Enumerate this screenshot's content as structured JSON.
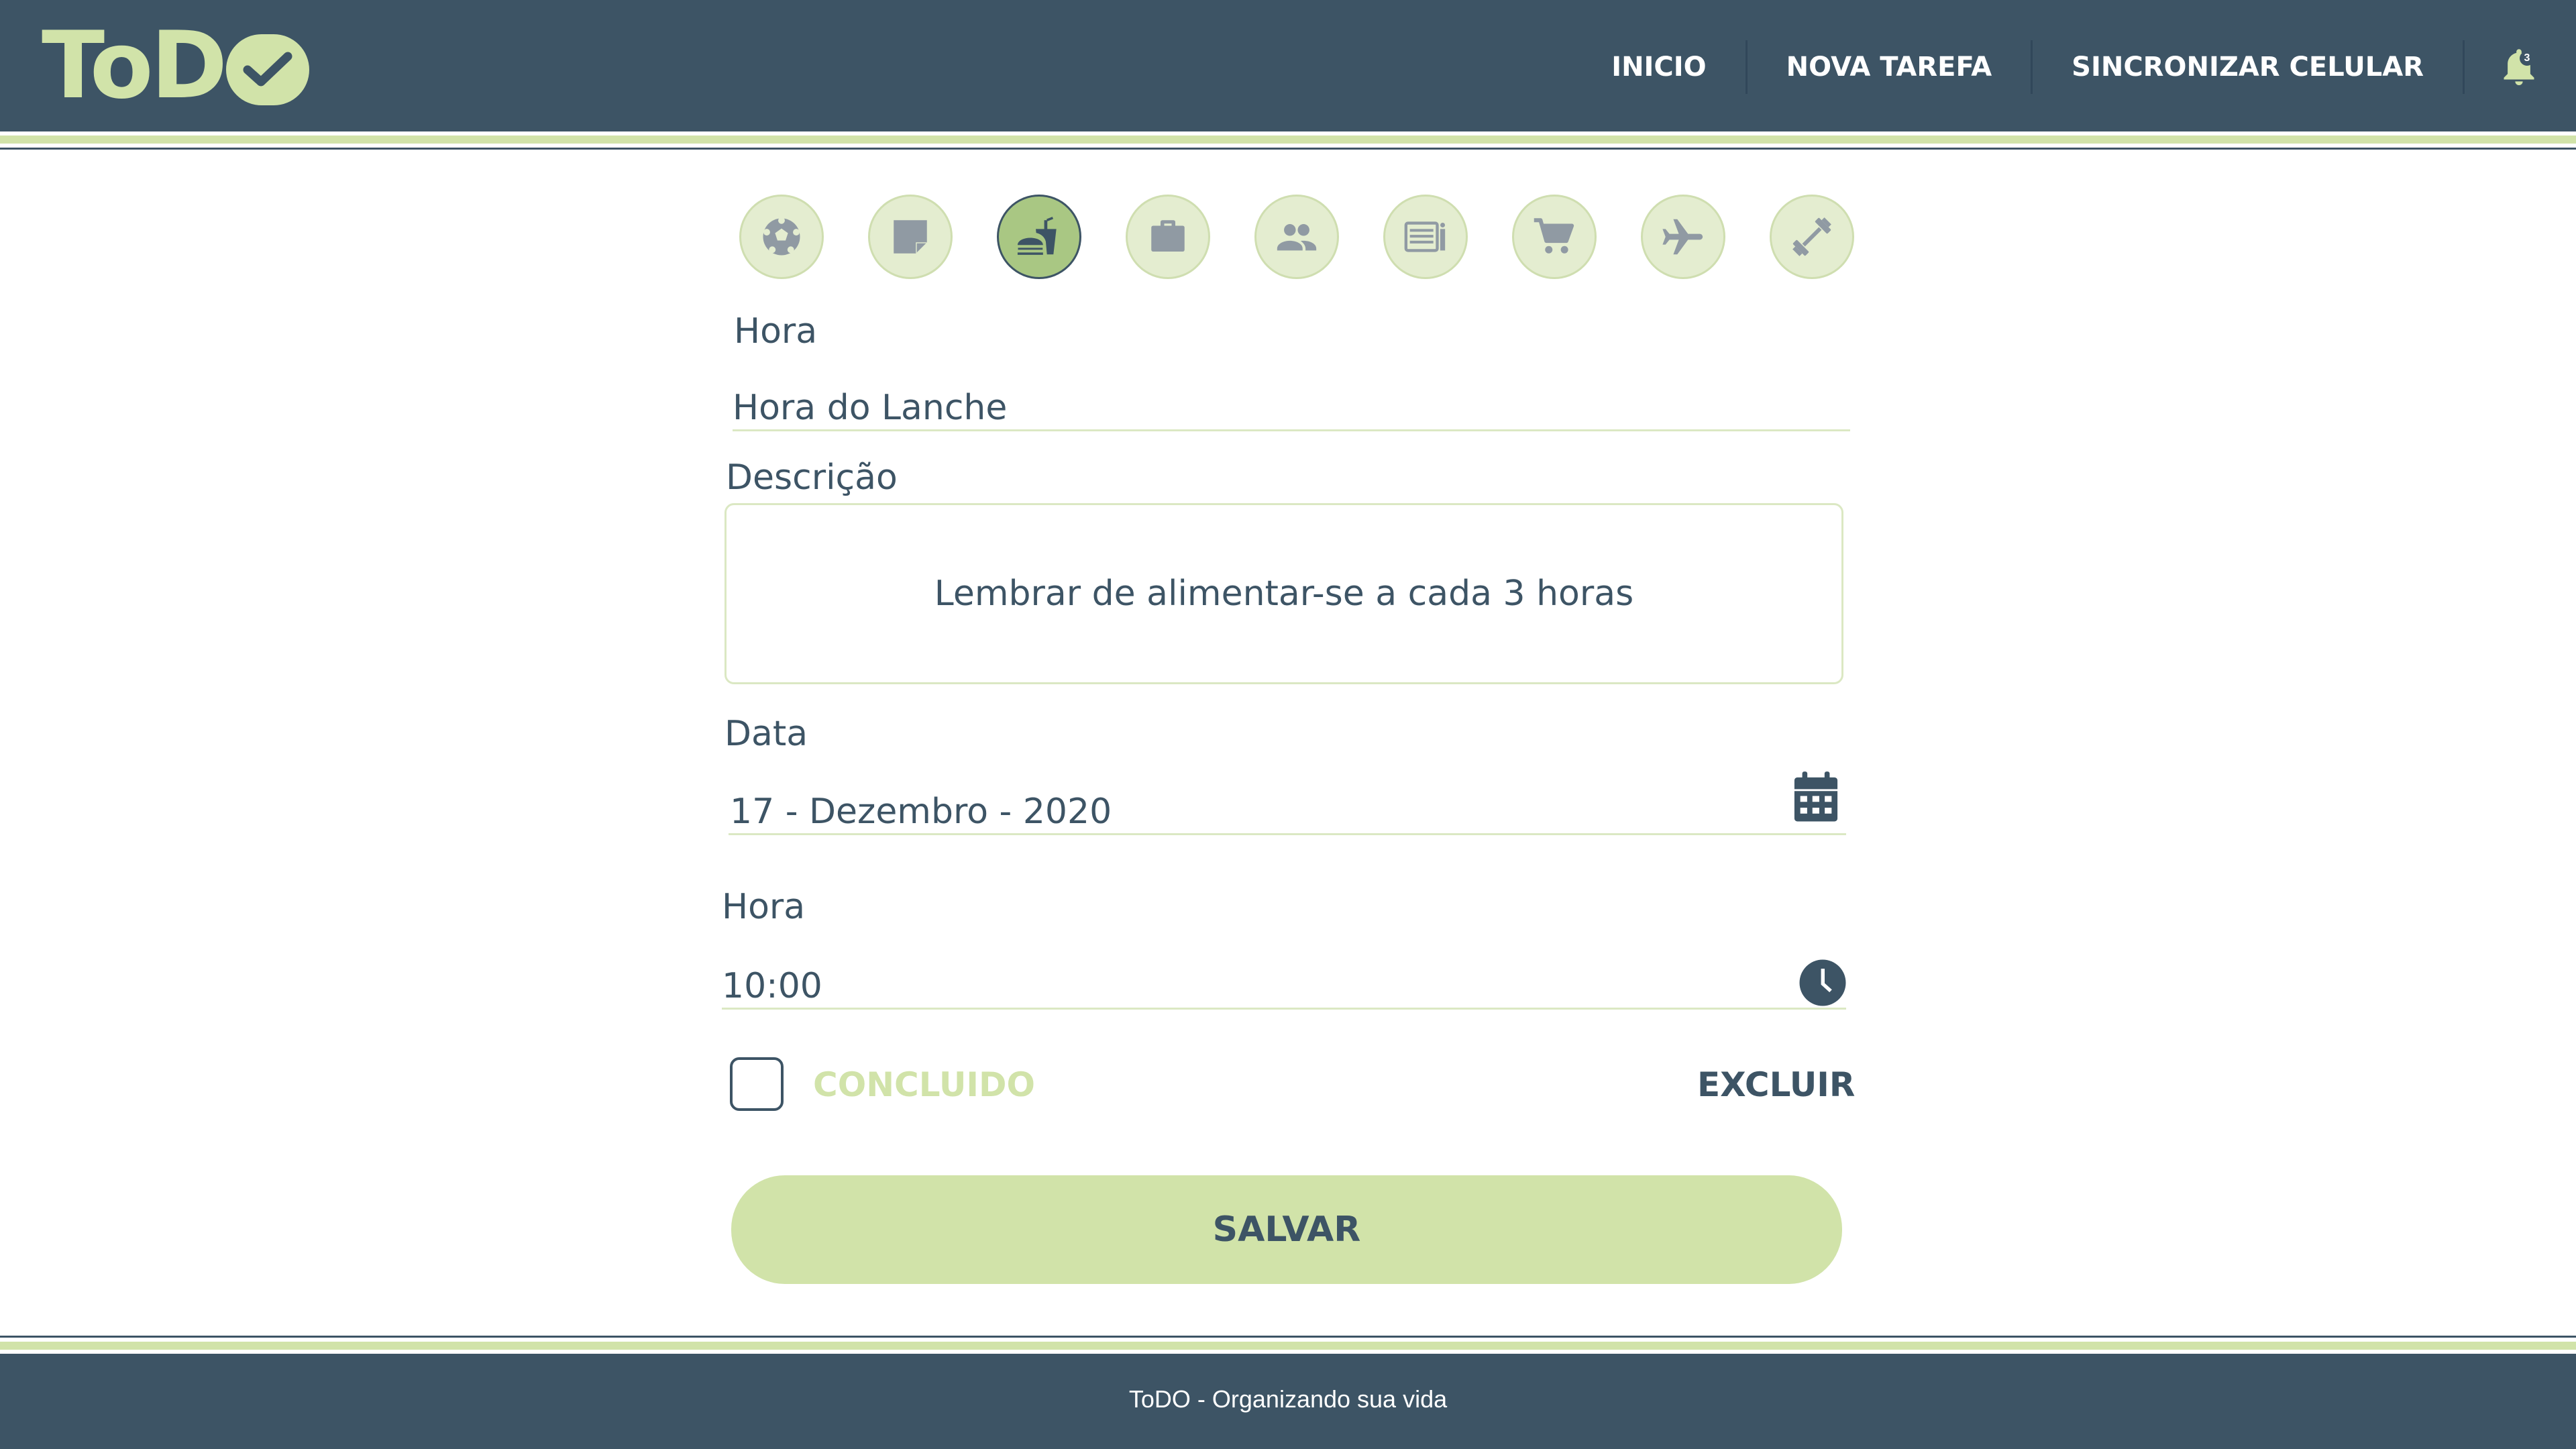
{
  "app": {
    "logo_text": "ToD",
    "brand_color": "#d1e3a9",
    "primary_color": "#3d5465"
  },
  "nav": {
    "items": [
      {
        "label": "INICIO"
      },
      {
        "label": "NOVA TAREFA"
      },
      {
        "label": "SINCRONIZAR CELULAR"
      }
    ],
    "notifications": {
      "icon": "bell-icon",
      "count": "3"
    }
  },
  "categories": [
    {
      "icon": "soccer-ball-icon",
      "selected": false
    },
    {
      "icon": "sticky-note-icon",
      "selected": false
    },
    {
      "icon": "fastfood-icon",
      "selected": true
    },
    {
      "icon": "briefcase-icon",
      "selected": false
    },
    {
      "icon": "people-icon",
      "selected": false
    },
    {
      "icon": "newspaper-icon",
      "selected": false
    },
    {
      "icon": "shopping-cart-icon",
      "selected": false
    },
    {
      "icon": "airplane-icon",
      "selected": false
    },
    {
      "icon": "dumbbell-icon",
      "selected": false
    }
  ],
  "form": {
    "title_label": "Hora",
    "title_value": "Hora do Lanche",
    "description_label": "Descrição",
    "description_value": "Lembrar de alimentar-se a cada 3 horas",
    "date_label": "Data",
    "date_value": "17 - Dezembro - 2020",
    "time_label": "Hora",
    "time_value": "10:00",
    "done_label": "CONCLUIDO",
    "done_checked": false,
    "delete_label": "EXCLUIR",
    "save_label": "SALVAR"
  },
  "footer": {
    "text": "ToDO - Organizando sua vida"
  }
}
